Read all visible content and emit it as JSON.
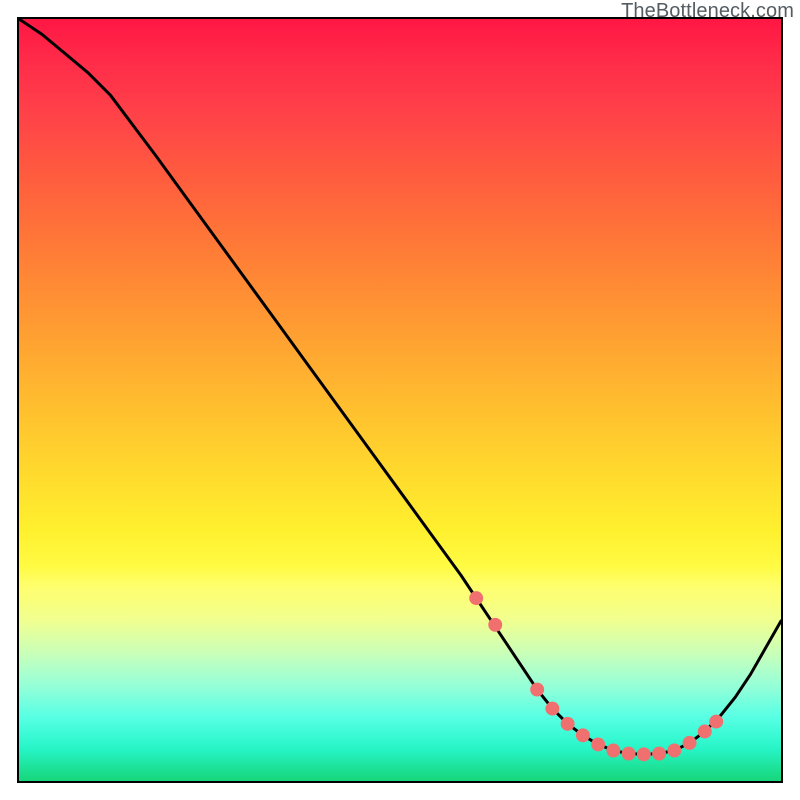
{
  "watermark": "TheBottleneck.com",
  "chart_data": {
    "type": "line",
    "title": "",
    "xlabel": "",
    "ylabel": "",
    "xlim": [
      0,
      100
    ],
    "ylim": [
      0,
      100
    ],
    "series": [
      {
        "name": "bottleneck-curve",
        "x": [
          0,
          3,
          6,
          9,
          12,
          15,
          18,
          22,
          26,
          30,
          34,
          38,
          42,
          46,
          50,
          54,
          58,
          60,
          62,
          64,
          66,
          68,
          70,
          72,
          74,
          76,
          78,
          80,
          82,
          84,
          86,
          88,
          90,
          92,
          94,
          96,
          98,
          100
        ],
        "y": [
          100,
          98,
          95.5,
          93,
          90,
          86,
          82,
          76.5,
          71,
          65.5,
          60,
          54.5,
          49,
          43.5,
          38,
          32.5,
          27,
          24,
          21,
          18,
          15,
          12,
          9.5,
          7.5,
          6,
          4.8,
          4,
          3.6,
          3.5,
          3.6,
          4,
          5,
          6.5,
          8.5,
          11,
          14,
          17.5,
          21
        ]
      }
    ],
    "markers": {
      "name": "highlight-points",
      "x": [
        60,
        62.5,
        68,
        70,
        72,
        74,
        76,
        78,
        80,
        82,
        84,
        86,
        88,
        90,
        91.5
      ],
      "y": [
        24,
        20.5,
        12,
        9.5,
        7.5,
        6,
        4.8,
        4,
        3.6,
        3.5,
        3.6,
        4,
        5,
        6.5,
        7.8
      ]
    },
    "marker_color": "#f07070",
    "curve_color": "#000000",
    "gradient": [
      "#ff1744",
      "#ffd52e",
      "#fffb44",
      "#17d67a"
    ]
  }
}
